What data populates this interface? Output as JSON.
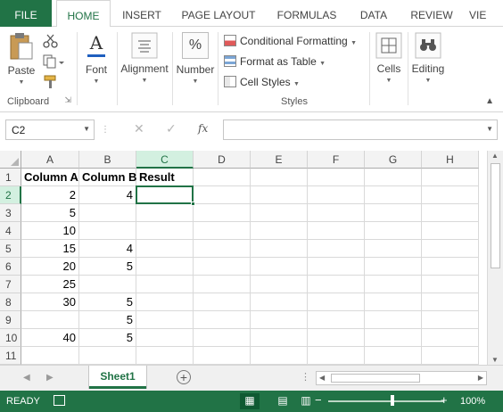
{
  "ribbon_tabs": [
    {
      "label": "FILE"
    },
    {
      "label": "HOME"
    },
    {
      "label": "INSERT"
    },
    {
      "label": "PAGE LAYOUT"
    },
    {
      "label": "FORMULAS"
    },
    {
      "label": "DATA"
    },
    {
      "label": "REVIEW"
    },
    {
      "label": "VIE"
    }
  ],
  "ribbon": {
    "clipboard": {
      "paste_label": "Paste",
      "group_label": "Clipboard"
    },
    "font": {
      "label": "Font"
    },
    "alignment": {
      "label": "Alignment"
    },
    "number": {
      "label": "Number"
    },
    "styles": {
      "conditional_formatting": "Conditional Formatting",
      "format_as_table": "Format as Table",
      "cell_styles": "Cell Styles",
      "group_label": "Styles"
    },
    "cells": {
      "label": "Cells"
    },
    "editing": {
      "label": "Editing"
    }
  },
  "formula_bar": {
    "name_box": "C2",
    "cancel_symbol": "✕",
    "enter_symbol": "✓",
    "fx_label": "fx",
    "formula_value": ""
  },
  "columns": [
    "A",
    "B",
    "C",
    "D",
    "E",
    "F",
    "G",
    "H"
  ],
  "selected_column": "C",
  "rows": [
    {
      "num": "1",
      "a": "Column A",
      "b": "Column B",
      "c": "Result"
    },
    {
      "num": "2",
      "a": "2",
      "b": "4",
      "c": ""
    },
    {
      "num": "3",
      "a": "5",
      "b": "",
      "c": ""
    },
    {
      "num": "4",
      "a": "10",
      "b": "",
      "c": ""
    },
    {
      "num": "5",
      "a": "15",
      "b": "4",
      "c": ""
    },
    {
      "num": "6",
      "a": "20",
      "b": "5",
      "c": ""
    },
    {
      "num": "7",
      "a": "25",
      "b": "",
      "c": ""
    },
    {
      "num": "8",
      "a": "30",
      "b": "5",
      "c": ""
    },
    {
      "num": "9",
      "a": "",
      "b": "5",
      "c": ""
    },
    {
      "num": "10",
      "a": "40",
      "b": "5",
      "c": ""
    },
    {
      "num": "11",
      "a": "",
      "b": "",
      "c": ""
    }
  ],
  "active_cell": "C2",
  "sheet_tabs": [
    {
      "label": "Sheet1",
      "active": true
    }
  ],
  "status_bar": {
    "state": "READY",
    "zoom": "100%"
  },
  "colors": {
    "accent": "#217346",
    "selected_header_bg": "#d3f0e0"
  }
}
